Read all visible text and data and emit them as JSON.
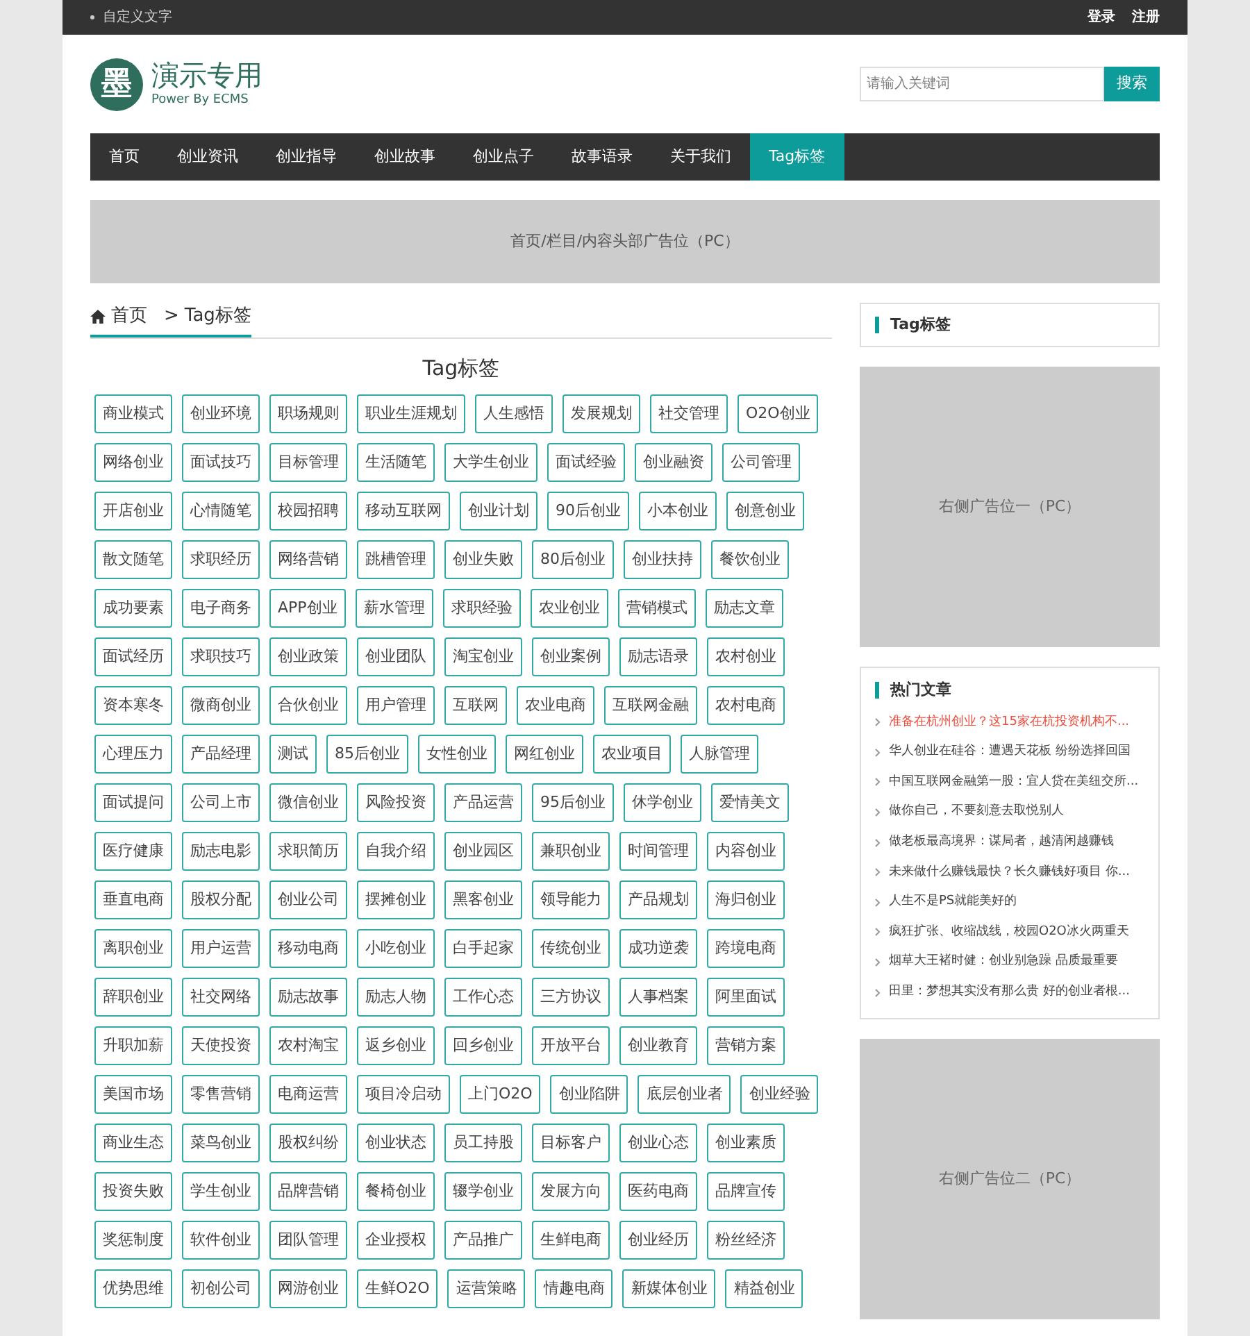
{
  "top_bar": {
    "tagline": "自定义文字",
    "links": [
      "登录",
      "注册"
    ]
  },
  "header": {
    "logo_mark": "墨",
    "site_name": "演示专用",
    "slogan": "Power By ECMS",
    "search": {
      "placeholder": "请输入关键词",
      "button": "搜索"
    }
  },
  "nav": [
    {
      "label": "首页",
      "selected": false
    },
    {
      "label": "创业资讯",
      "selected": false
    },
    {
      "label": "创业指导",
      "selected": false
    },
    {
      "label": "创业故事",
      "selected": false
    },
    {
      "label": "创业点子",
      "selected": false
    },
    {
      "label": "故事语录",
      "selected": false
    },
    {
      "label": "关于我们",
      "selected": false
    },
    {
      "label": "Tag标签",
      "selected": true
    }
  ],
  "top_ad": "首页/栏目/内容头部广告位（PC）",
  "breadcrumb": {
    "home": "首页",
    "separator": ">",
    "current": "Tag标签"
  },
  "page_title": "Tag标签",
  "tag_rows": [
    [
      "商业模式",
      "创业环境",
      "职场规则",
      "职业生涯规划",
      "人生感悟",
      "发展规划",
      "社交管理",
      "O2O创业"
    ],
    [
      "网络创业",
      "面试技巧",
      "目标管理",
      "生活随笔",
      "大学生创业",
      "面试经验",
      "创业融资",
      "公司管理"
    ],
    [
      "开店创业",
      "心情随笔",
      "校园招聘",
      "移动互联网",
      "创业计划",
      "90后创业",
      "小本创业",
      "创意创业"
    ],
    [
      "散文随笔",
      "求职经历",
      "网络营销",
      "跳槽管理",
      "创业失败",
      "80后创业",
      "创业扶持",
      "餐饮创业"
    ],
    [
      "成功要素",
      "电子商务",
      "APP创业",
      "薪水管理",
      "求职经验",
      "农业创业",
      "营销模式",
      "励志文章"
    ],
    [
      "面试经历",
      "求职技巧",
      "创业政策",
      "创业团队",
      "淘宝创业",
      "创业案例",
      "励志语录",
      "农村创业"
    ],
    [
      "资本寒冬",
      "微商创业",
      "合伙创业",
      "用户管理",
      "互联网",
      "农业电商",
      "互联网金融",
      "农村电商"
    ],
    [
      "心理压力",
      "产品经理",
      "测试",
      "85后创业",
      "女性创业",
      "网红创业",
      "农业项目",
      "人脉管理"
    ],
    [
      "面试提问",
      "公司上市",
      "微信创业",
      "风险投资",
      "产品运营",
      "95后创业",
      "休学创业",
      "爱情美文"
    ],
    [
      "医疗健康",
      "励志电影",
      "求职简历",
      "自我介绍",
      "创业园区",
      "兼职创业",
      "时间管理",
      "内容创业"
    ],
    [
      "垂直电商",
      "股权分配",
      "创业公司",
      "摆摊创业",
      "黑客创业",
      "领导能力",
      "产品规划",
      "海归创业"
    ],
    [
      "离职创业",
      "用户运营",
      "移动电商",
      "小吃创业",
      "白手起家",
      "传统创业",
      "成功逆袭",
      "跨境电商"
    ],
    [
      "辞职创业",
      "社交网络",
      "励志故事",
      "励志人物",
      "工作心态",
      "三方协议",
      "人事档案",
      "阿里面试"
    ],
    [
      "升职加薪",
      "天使投资",
      "农村淘宝",
      "返乡创业",
      "回乡创业",
      "开放平台",
      "创业教育",
      "营销方案"
    ],
    [
      "美国市场",
      "零售营销",
      "电商运营",
      "项目冷启动",
      "上门O2O",
      "创业陷阱",
      "底层创业者",
      "创业经验"
    ],
    [
      "商业生态",
      "菜鸟创业",
      "股权纠纷",
      "创业状态",
      "员工持股",
      "目标客户",
      "创业心态",
      "创业素质"
    ],
    [
      "投资失败",
      "学生创业",
      "品牌营销",
      "餐椅创业",
      "辍学创业",
      "发展方向",
      "医药电商",
      "品牌宣传"
    ],
    [
      "奖惩制度",
      "软件创业",
      "团队管理",
      "企业授权",
      "产品推广",
      "生鲜电商",
      "创业经历",
      "粉丝经济"
    ],
    [
      "优势思维",
      "初创公司",
      "网游创业",
      "生鲜O2O",
      "运营策略",
      "情趣电商",
      "新媒体创业",
      "精益创业"
    ]
  ],
  "sidebar": {
    "tag_box_title": "Tag标签",
    "ad_one": "右侧广告位一（PC）",
    "hot": {
      "title": "热门文章",
      "items": [
        {
          "text": "准备在杭州创业？这15家在杭投资机构不...",
          "highlighted": true
        },
        {
          "text": "华人创业在硅谷：遭遇天花板 纷纷选择回国",
          "highlighted": false
        },
        {
          "text": "中国互联网金融第一股：宜人贷在美纽交所...",
          "highlighted": false
        },
        {
          "text": "做你自己，不要刻意去取悦别人",
          "highlighted": false
        },
        {
          "text": "做老板最高境界：谋局者，越清闲越赚钱",
          "highlighted": false
        },
        {
          "text": "未来做什么赚钱最快？长久赚钱好项目 你...",
          "highlighted": false
        },
        {
          "text": "人生不是PS就能美好的",
          "highlighted": false
        },
        {
          "text": "疯狂扩张、收缩战线，校园O2O冰火两重天",
          "highlighted": false
        },
        {
          "text": "烟草大王褚时健：创业别急躁 品质最重要",
          "highlighted": false
        },
        {
          "text": "田里：梦想其实没有那么贵 好的创业者根...",
          "highlighted": false
        }
      ]
    },
    "ad_two": "右侧广告位二（PC）"
  }
}
